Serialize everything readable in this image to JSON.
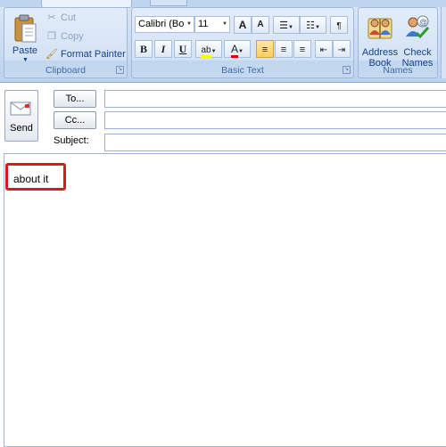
{
  "ribbon": {
    "clipboard": {
      "paste": "Paste",
      "cut": "Cut",
      "copy": "Copy",
      "format_painter": "Format Painter",
      "label": "Clipboard"
    },
    "basic_text": {
      "font_name": "Calibri (Bo",
      "font_size": "11",
      "bold": "B",
      "italic": "I",
      "underline": "U",
      "grow_font": "A",
      "shrink_font": "A",
      "label": "Basic Text"
    },
    "names": {
      "address_book_line1": "Address",
      "address_book_line2": "Book",
      "check_names_line1": "Check",
      "check_names_line2": "Names",
      "label": "Names"
    }
  },
  "header": {
    "send": "Send",
    "to": "To...",
    "cc": "Cc...",
    "subject_label": "Subject:",
    "to_value": "",
    "cc_value": "",
    "subject_value": ""
  },
  "body": {
    "text": "about it"
  },
  "colors": {
    "highlight_border": "#e0151d",
    "ribbon_bg": "#c9dbf2",
    "label_text": "#15428b"
  }
}
